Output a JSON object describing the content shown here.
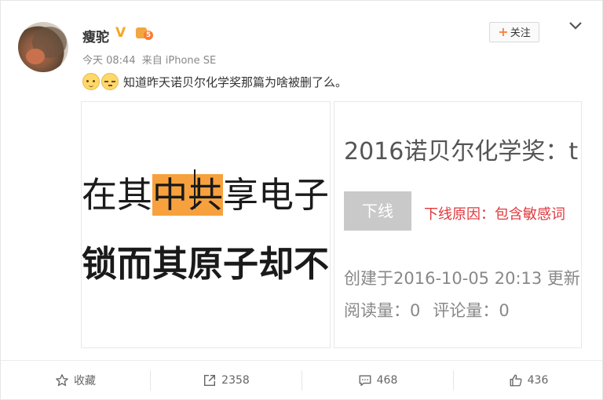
{
  "post": {
    "username": "瘦驼",
    "time": "今天 08:44",
    "source_prefix": "来自",
    "source": "iPhone SE",
    "follow_label": "关注",
    "text": "知道昨天诺贝尔化学奖那篇为啥被删了么。",
    "level_badge": "5"
  },
  "image_left": {
    "line1_pre": "在其",
    "line1_hl1": "中",
    "line1_hl2": "共",
    "line1_post": "享电子",
    "line2": "锁而其原子却不"
  },
  "image_right": {
    "title": "2016诺贝尔化学奖：t",
    "offline_label": "下线",
    "reason": "下线原因：包含敏感词",
    "created": "创建于2016-10-05 20:13  更新",
    "read_count": "阅读量：0",
    "comment_count": "评论量：0"
  },
  "footer": {
    "favorite_label": "收藏",
    "repost_count": "2358",
    "comment_count": "468",
    "like_count": "436"
  },
  "colors": {
    "accent_orange": "#ff8140",
    "highlight": "#f7a13e",
    "warning_red": "#e0383e",
    "verified_gold": "#f5a623"
  }
}
